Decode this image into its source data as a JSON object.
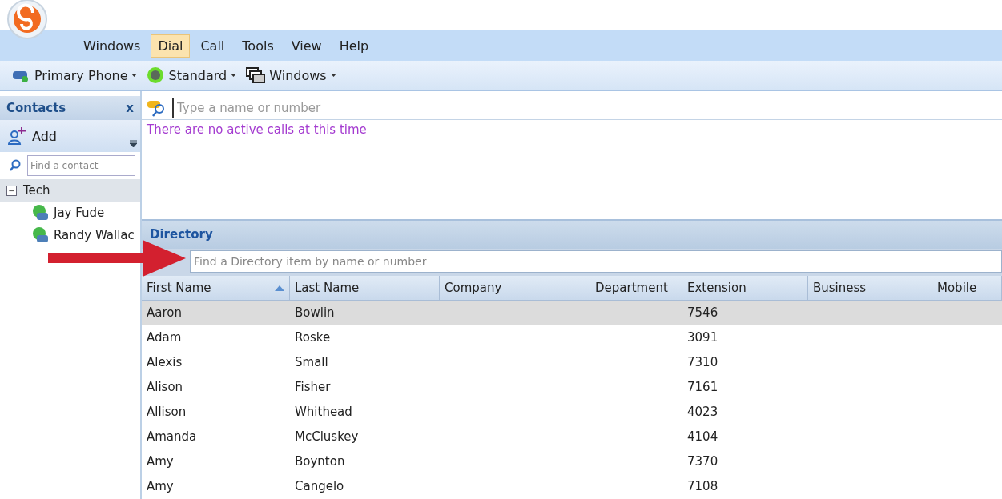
{
  "menu": [
    {
      "label": "Windows",
      "selected": false
    },
    {
      "label": "Dial",
      "selected": true
    },
    {
      "label": "Call",
      "selected": false
    },
    {
      "label": "Tools",
      "selected": false
    },
    {
      "label": "View",
      "selected": false
    },
    {
      "label": "Help",
      "selected": false
    }
  ],
  "toolbar": [
    {
      "label": "Primary Phone",
      "kind": "phone"
    },
    {
      "label": "Standard",
      "kind": "status"
    },
    {
      "label": "Windows",
      "kind": "windows"
    }
  ],
  "contacts": {
    "title": "Contacts",
    "close": "x",
    "add": "Add",
    "search_placeholder": "Find a contact",
    "groups": [
      {
        "name": "Tech",
        "expanded": true,
        "toggle": "−",
        "children": [
          {
            "name": "Jay Fude"
          },
          {
            "name": "Randy Wallac"
          }
        ]
      }
    ]
  },
  "dial": {
    "placeholder": "Type a name or number",
    "status": "There are no active calls at this time"
  },
  "directory": {
    "title": "Directory",
    "search_placeholder": "Find a Directory item by name or number",
    "columns": [
      {
        "label": "First Name",
        "sorted": true
      },
      {
        "label": "Last Name",
        "sorted": false
      },
      {
        "label": "Company",
        "sorted": false
      },
      {
        "label": "Department",
        "sorted": false
      },
      {
        "label": "Extension",
        "sorted": false
      },
      {
        "label": "Business",
        "sorted": false
      },
      {
        "label": "Mobile",
        "sorted": false
      }
    ],
    "rows": [
      {
        "selected": true,
        "cells": [
          "Aaron",
          "Bowlin",
          "",
          "",
          "7546",
          "",
          ""
        ]
      },
      {
        "selected": false,
        "cells": [
          "Adam",
          "Roske",
          "",
          "",
          "3091",
          "",
          ""
        ]
      },
      {
        "selected": false,
        "cells": [
          "Alexis",
          "Small",
          "",
          "",
          "7310",
          "",
          ""
        ]
      },
      {
        "selected": false,
        "cells": [
          "Alison",
          "Fisher",
          "",
          "",
          "7161",
          "",
          ""
        ]
      },
      {
        "selected": false,
        "cells": [
          "Allison",
          "Whithead",
          "",
          "",
          "4023",
          "",
          ""
        ]
      },
      {
        "selected": false,
        "cells": [
          "Amanda",
          "McCluskey",
          "",
          "",
          "4104",
          "",
          ""
        ]
      },
      {
        "selected": false,
        "cells": [
          "Amy",
          "Boynton",
          "",
          "",
          "7370",
          "",
          ""
        ]
      },
      {
        "selected": false,
        "cells": [
          "Amy",
          "Cangelo",
          "",
          "",
          "7108",
          "",
          ""
        ]
      }
    ]
  }
}
